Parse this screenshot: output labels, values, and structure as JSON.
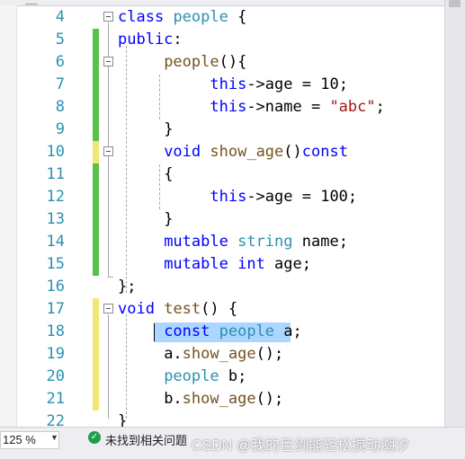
{
  "editor": {
    "lines": [
      {
        "num": "4"
      },
      {
        "num": "5"
      },
      {
        "num": "6"
      },
      {
        "num": "7"
      },
      {
        "num": "8"
      },
      {
        "num": "9"
      },
      {
        "num": "10"
      },
      {
        "num": "11"
      },
      {
        "num": "12"
      },
      {
        "num": "13"
      },
      {
        "num": "14"
      },
      {
        "num": "15"
      },
      {
        "num": "16"
      },
      {
        "num": "17"
      },
      {
        "num": "18"
      },
      {
        "num": "19"
      },
      {
        "num": "20"
      },
      {
        "num": "21"
      },
      {
        "num": "22"
      }
    ],
    "tokens": {
      "class": "class",
      "people": "people",
      "brace_open": " {",
      "public": "public",
      "colon": ":",
      "ctor_name": "people",
      "ctor_sig": "(){",
      "this": "this",
      "arrow_age": "->age = ",
      "ten": "10",
      "semi": ";",
      "arrow_name": "->name = ",
      "abc": "\"abc\"",
      "close_brace": "}",
      "void": "void",
      "show_age": "show_age",
      "parens": "()",
      "const": "const",
      "open_brace": "{",
      "hundred": "100",
      "mutable": "mutable",
      "string": "string",
      "name_decl": " name;",
      "int": "int",
      "age_decl": " age;",
      "class_end": "};",
      "test": "test",
      "test_sig": "() {",
      "people_a": " a;",
      "a_call": "a.",
      "call_end": "();",
      "people_b": " b;",
      "b_call": "b.",
      "last": "}"
    }
  },
  "colors": {
    "saved_change": "#57c14b",
    "unsaved_change": "#f4e672",
    "keyword": "#0000ff",
    "string": "#a31515",
    "type": "#2b91af",
    "function": "#74531f",
    "selection": "#add6ff"
  },
  "statusbar": {
    "zoom": "125 %",
    "zoom_icon": "chevron-down-icon",
    "issues_icon": "check-circle-icon",
    "issues_text": "未找到相关问题",
    "watermark": "CSDN @我的巨剑能轻松搅动潮汐"
  }
}
